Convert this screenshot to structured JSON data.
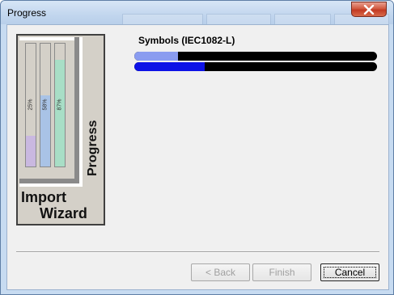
{
  "window": {
    "title": "Progress"
  },
  "wizard_art": {
    "word1": "Import",
    "word2": "Wizard",
    "word3": "Progress",
    "tubes": [
      {
        "label": "25%",
        "level": 0.25,
        "color": "#c9b8e0"
      },
      {
        "label": "58%",
        "level": 0.58,
        "color": "#a9c3e6"
      },
      {
        "label": "87%",
        "level": 0.87,
        "color": "#a8dec6"
      }
    ]
  },
  "progress": {
    "operation_label": "Symbols (IEC1082-L)",
    "bars": [
      {
        "name": "item-progress",
        "level": 0.18,
        "color": "#8a9cf0"
      },
      {
        "name": "overall-progress",
        "level": 0.29,
        "color": "#0d12e6"
      }
    ]
  },
  "buttons": {
    "back": "< Back",
    "finish": "Finish",
    "cancel": "Cancel"
  },
  "colors": {
    "close_button": "#c9412a",
    "title_bar": "#c7dbf1"
  }
}
